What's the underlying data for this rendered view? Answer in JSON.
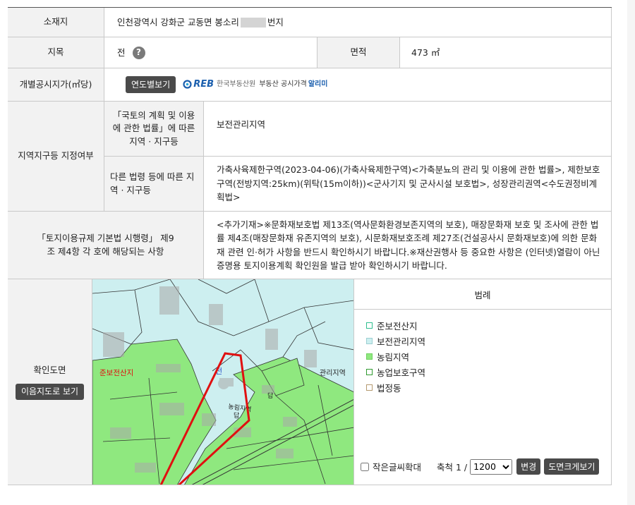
{
  "rows": {
    "location": {
      "label": "소재지",
      "value": "인천광역시 강화군 교동면 봉소리",
      "suffix": "번지"
    },
    "category": {
      "label": "지목",
      "value": "전",
      "help_icon": "question-icon",
      "help_text": "?"
    },
    "area": {
      "label": "면적",
      "value": "473 ㎡"
    },
    "price": {
      "label": "개별공시지가(㎡당)",
      "button": "연도별보기",
      "banner": {
        "logo": "REB",
        "org": "한국부동산원",
        "service": "부동산 공시가격",
        "app": "알리미"
      }
    },
    "zone": {
      "label": "지역지구등 지정여부",
      "sub1": {
        "label": "「국토의 계획 및 이용 에 관한 법률」에 따른 지역 · 지구등",
        "value": "보전관리지역"
      },
      "sub2": {
        "label": "다른 법령 등에 따른 지역 · 지구등",
        "value": "가축사육제한구역(2023-04-06)(가축사육제한구역)<가축분뇨의 관리 및 이용에 관한 법률>, 제한보호구역(전방지역:25km)(위탁(15m이하))<군사기지 및 군사시설 보호법>, 성장관리권역<수도권정비계획법>"
      }
    },
    "regulation": {
      "label": "「토지이용규제 기본법 시행령」 제9조 제4항 각 호에 해당되는 사항",
      "value": "<추가기재>※문화재보호법 제13조(역사문화환경보존지역의 보호), 매장문화재 보호 및 조사에 관한 법률 제4조(매장문화재 유존지역의 보호), 시문화재보호조례 제27조(건설공사시 문화재보호)에 의한 문화재 관련 인·허가 사항을 반드시 확인하시기 바랍니다.※재산권행사 등 중요한 사항은 (인터넷)열람이 아닌 증명용 토지이용계획 확인원을 발급 받아 확인하시기 바랍니다."
    },
    "map": {
      "label": "확인도면",
      "button": "이음지도로 보기"
    }
  },
  "map_labels": {
    "zone1": "준보전산지",
    "zone2": "관리지역",
    "zone3": "농림지역",
    "lot": "답",
    "lot2": "답",
    "parcel": "전"
  },
  "legend": {
    "title": "범례",
    "items": [
      {
        "label": "준보전산지",
        "fill": "#ffffff",
        "border": "#2fbf8f"
      },
      {
        "label": "보전관리지역",
        "fill": "#cdeff0",
        "border": "#9ccfd2"
      },
      {
        "label": "농림지역",
        "fill": "#8fe87f",
        "border": "#6fd15f"
      },
      {
        "label": "농업보호구역",
        "fill": "#ffffff",
        "border": "#2f9a2f"
      },
      {
        "label": "법정동",
        "fill": "#ffffff",
        "border": "#b59a70"
      }
    ]
  },
  "map_controls": {
    "small_text_zoom": "작은글씨확대",
    "scale_label": "축척 1 /",
    "scale_value": "1200",
    "scale_options": [
      "1200"
    ],
    "change_button": "변경",
    "view_large_button": "도면크게보기"
  },
  "colors": {
    "header_bg": "#f2f2f2",
    "button_bg": "#4a4a4a",
    "map_green": "#8fe87f",
    "map_cyan": "#cdeff0",
    "outline_red": "#e01010"
  }
}
